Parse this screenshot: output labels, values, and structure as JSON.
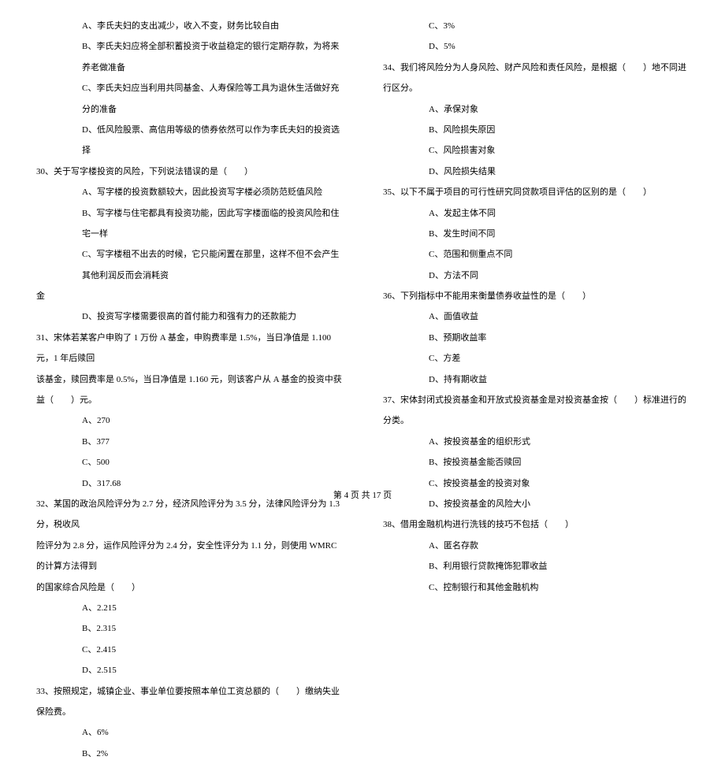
{
  "leftColumn": {
    "q29_optA": "A、李氏夫妇的支出减少，收入不变，财务比较自由",
    "q29_optB": "B、李氏夫妇应将全部积蓄投资于收益稳定的银行定期存款，为将来养老做准备",
    "q29_optC": "C、李氏夫妇应当利用共同基金、人寿保险等工具为退休生活做好充分的准备",
    "q29_optD": "D、低风险股票、高信用等级的债券依然可以作为李氏夫妇的投资选择",
    "q30_stem": "30、关于写字楼投资的风险，下列说法错误的是（　　）",
    "q30_optA": "A、写字楼的投资数额较大，因此投资写字楼必须防范贬值风险",
    "q30_optB": "B、写字楼与住宅都具有投资功能，因此写字楼面临的投资风险和住宅一样",
    "q30_optC": "C、写字楼租不出去的时候，它只能闲置在那里，这样不但不会产生其他利润反而会消耗资",
    "q30_optC_cont": "金",
    "q30_optD": "D、投资写字楼需要很高的首付能力和强有力的还款能力",
    "q31_stem": "31、宋体若某客户申购了 1 万份 A 基金，申购费率是 1.5%，当日净值是 1.100 元，1 年后赎回",
    "q31_stem2": "该基金，赎回费率是 0.5%，当日净值是 1.160 元，则该客户从 A 基金的投资中获益（　　）元。",
    "q31_optA": "A、270",
    "q31_optB": "B、377",
    "q31_optC": "C、500",
    "q31_optD": "D、317.68",
    "q32_stem": "32、某国的政治风险评分为 2.7 分，经济风险评分为 3.5 分，法律风险评分为 1.3 分，税收风",
    "q32_stem2": "险评分为 2.8 分，运作风险评分为 2.4 分，安全性评分为 1.1 分，则使用 WMRC 的计算方法得到",
    "q32_stem3": "的国家综合风险是（　　）",
    "q32_optA": "A、2.215",
    "q32_optB": "B、2.315",
    "q32_optC": "C、2.415",
    "q32_optD": "D、2.515",
    "q33_stem": "33、按照规定，城镇企业、事业单位要按照本单位工资总额的（　　）缴纳失业保险费。",
    "q33_optA": "A、6%",
    "q33_optB": "B、2%"
  },
  "rightColumn": {
    "q33_optC": "C、3%",
    "q33_optD": "D、5%",
    "q34_stem": "34、我们将风险分为人身风险、财产风险和责任风险，是根据（　　）地不同进行区分。",
    "q34_optA": "A、承保对象",
    "q34_optB": "B、风险损失原因",
    "q34_optC": "C、风险损害对象",
    "q34_optD": "D、风险损失结果",
    "q35_stem": "35、以下不属于项目的可行性研究同贷款项目评估的区别的是（　　）",
    "q35_optA": "A、发起主体不同",
    "q35_optB": "B、发生时间不同",
    "q35_optC": "C、范围和侧重点不同",
    "q35_optD": "D、方法不同",
    "q36_stem": "36、下列指标中不能用来衡量债券收益性的是（　　）",
    "q36_optA": "A、面值收益",
    "q36_optB": "B、预期收益率",
    "q36_optC": "C、方差",
    "q36_optD": "D、持有期收益",
    "q37_stem": "37、宋体封闭式投资基金和开放式投资基金是对投资基金按（　　）标准进行的分类。",
    "q37_optA": "A、按投资基金的组织形式",
    "q37_optB": "B、按投资基金能否赎回",
    "q37_optC": "C、按投资基金的投资对象",
    "q37_optD": "D、按投资基金的风险大小",
    "q38_stem": "38、借用金融机构进行洗钱的技巧不包括（　　）",
    "q38_optA": "A、匿名存款",
    "q38_optB": "B、利用银行贷款掩饰犯罪收益",
    "q38_optC": "C、控制银行和其他金融机构"
  },
  "footer": "第 4 页 共 17 页"
}
